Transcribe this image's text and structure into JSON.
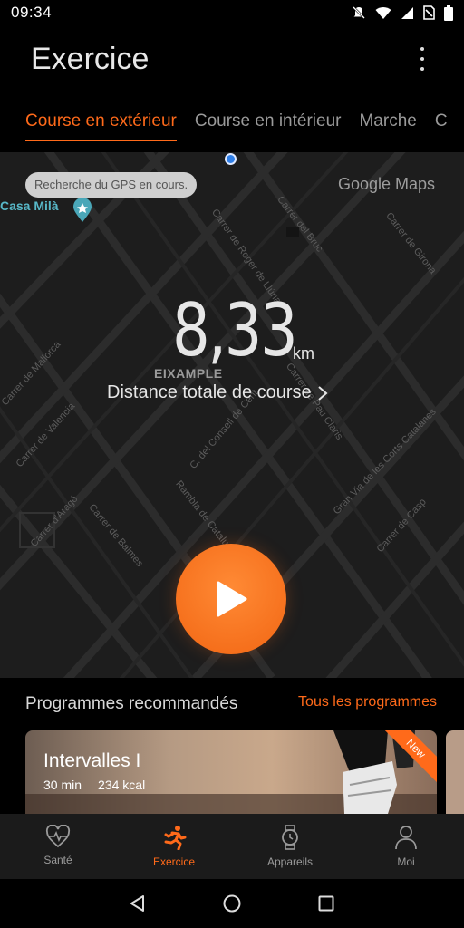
{
  "status_bar": {
    "time": "09:34"
  },
  "header": {
    "title": "Exercice"
  },
  "tabs": [
    {
      "label": "Course en extérieur"
    },
    {
      "label": "Course en intérieur"
    },
    {
      "label": "Marche"
    },
    {
      "label": "C"
    }
  ],
  "map": {
    "gps_status": "Recherche du GPS en cours.",
    "provider": "Google Maps",
    "poi": "Casa Milà",
    "district": "EIXAMPLE",
    "streets": [
      "Carrer del Bruc",
      "Carrer de Girona",
      "Carrer de Roger de Llúria",
      "Carrer de Mallorca",
      "Carrer de Valencia",
      "Carrer de Pau Claris",
      "C. del Consell de Cent",
      "Gran Via de les Corts Catalanes",
      "Rambla de Catalunya",
      "Carrer d'Aragó",
      "Carrer de Balmes",
      "Carrer de Casp"
    ]
  },
  "distance": {
    "value": "8,33",
    "unit": "km",
    "label": "Distance totale de course"
  },
  "programs": {
    "title": "Programmes recommandés",
    "link": "Tous les programmes",
    "cards": [
      {
        "title": "Intervalles I",
        "duration": "30 min",
        "calories": "234 kcal",
        "badge": "New"
      }
    ]
  },
  "bottom_nav": [
    {
      "label": "Santé",
      "icon": "heart-rate-icon"
    },
    {
      "label": "Exercice",
      "icon": "runner-icon",
      "active": true
    },
    {
      "label": "Appareils",
      "icon": "watch-icon"
    },
    {
      "label": "Moi",
      "icon": "person-icon"
    }
  ],
  "colors": {
    "accent": "#ff6a1a",
    "background": "#000000",
    "map": "#1d1d1d"
  }
}
